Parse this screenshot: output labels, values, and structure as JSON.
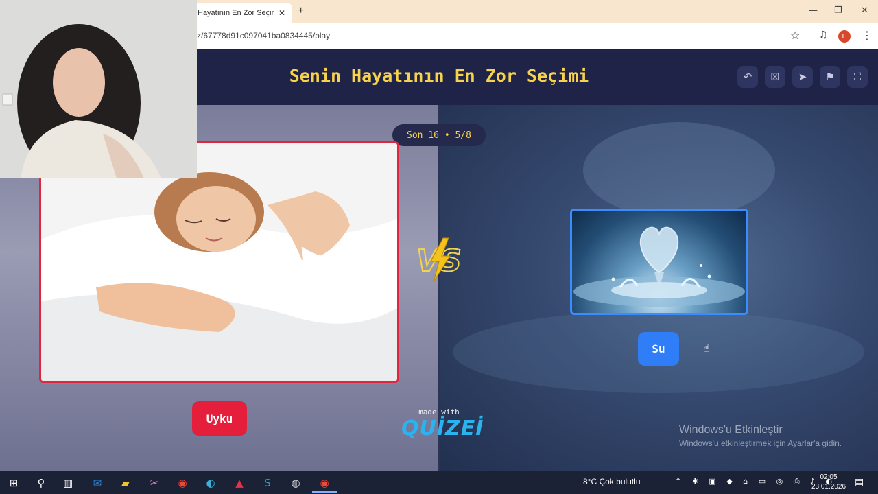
{
  "browser": {
    "tab_title": "Hayatının En Zor Seçimi",
    "tab_close": "✕",
    "new_tab": "+",
    "url": "z/67778d91c097041ba0834445/play",
    "window_controls": {
      "minimize": "—",
      "maximize": "❐",
      "close": "✕"
    },
    "profile_initial": "E",
    "icons": [
      "star-icon",
      "media-control-icon",
      "profile-avatar",
      "kebab-menu-icon"
    ]
  },
  "game": {
    "title": "Senin Hayatının En Zor Seçimi",
    "round": "Son 16 • 5/8",
    "toolbar_icons": [
      "undo-icon",
      "dice-icon",
      "share-icon",
      "report-flag-icon",
      "fullscreen-icon"
    ],
    "vs_label": "VS",
    "left_choice": {
      "label": "Uyku",
      "accent": "#e51f3b"
    },
    "right_choice": {
      "label": "Su",
      "accent": "#2f7ef7"
    },
    "made_with": "made with",
    "brand": "QUİZEİ",
    "title_color": "#f7d24b"
  },
  "watermark": {
    "title": "Windows'u Etkinleştir",
    "subtitle": "Windows'u etkinleştirmek için Ayarlar'a gidin."
  },
  "taskbar": {
    "apps": [
      "windows-start-icon",
      "search-icon",
      "task-view-icon",
      "outlook-icon",
      "file-explorer-icon",
      "snipping-icon",
      "chrome-icon",
      "edge-icon",
      "access-icon",
      "sway-icon",
      "obs-icon",
      "chrome-active-icon"
    ],
    "weather": "8°C  Çok bulutlu",
    "tray": "^ ✱ ▣ ◆ ⌂ ▭ ◎ ⎙ ♪ ◐",
    "time": "02:05",
    "date": "23.01.2026"
  }
}
